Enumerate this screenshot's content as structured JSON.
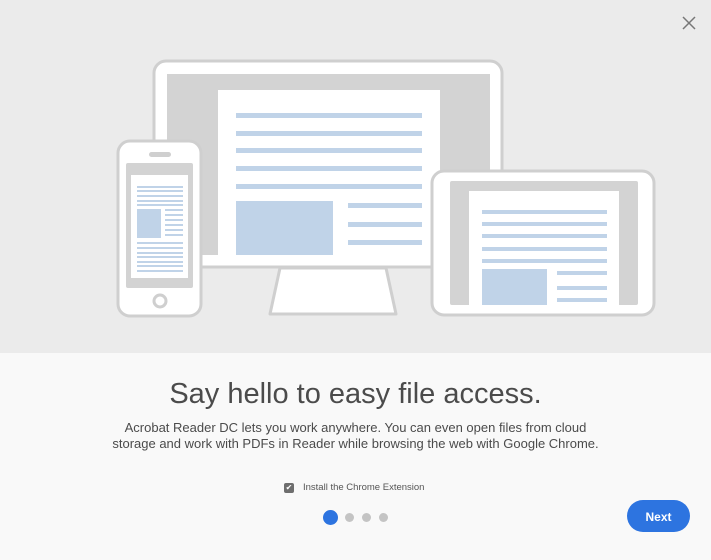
{
  "title": "Say hello to easy file access.",
  "description": "Acrobat Reader DC lets you work anywhere. You can even open files from cloud storage and work with PDFs in Reader while browsing the web with Google Chrome.",
  "checkbox": {
    "label": "Install the Chrome Extension",
    "checked": true
  },
  "pagination": {
    "current": 1,
    "total": 4
  },
  "next_label": "Next",
  "colors": {
    "accent": "#2d74e0",
    "hero_bg": "#ebebeb",
    "line": "#c0d3e8"
  }
}
